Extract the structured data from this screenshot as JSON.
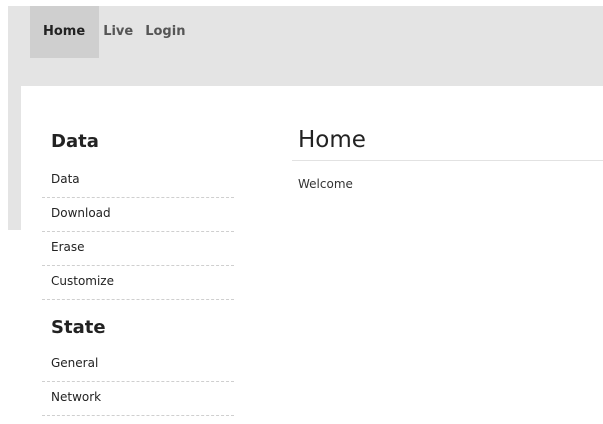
{
  "nav": {
    "items": [
      {
        "label": "Home"
      },
      {
        "label": "Live"
      },
      {
        "label": "Login"
      }
    ]
  },
  "sidebar": {
    "sections": [
      {
        "heading": "Data",
        "items": [
          "Data",
          "Download",
          "Erase",
          "Customize"
        ]
      },
      {
        "heading": "State",
        "items": [
          "General",
          "Network"
        ]
      }
    ]
  },
  "main": {
    "title": "Home",
    "text": "Welcome"
  }
}
